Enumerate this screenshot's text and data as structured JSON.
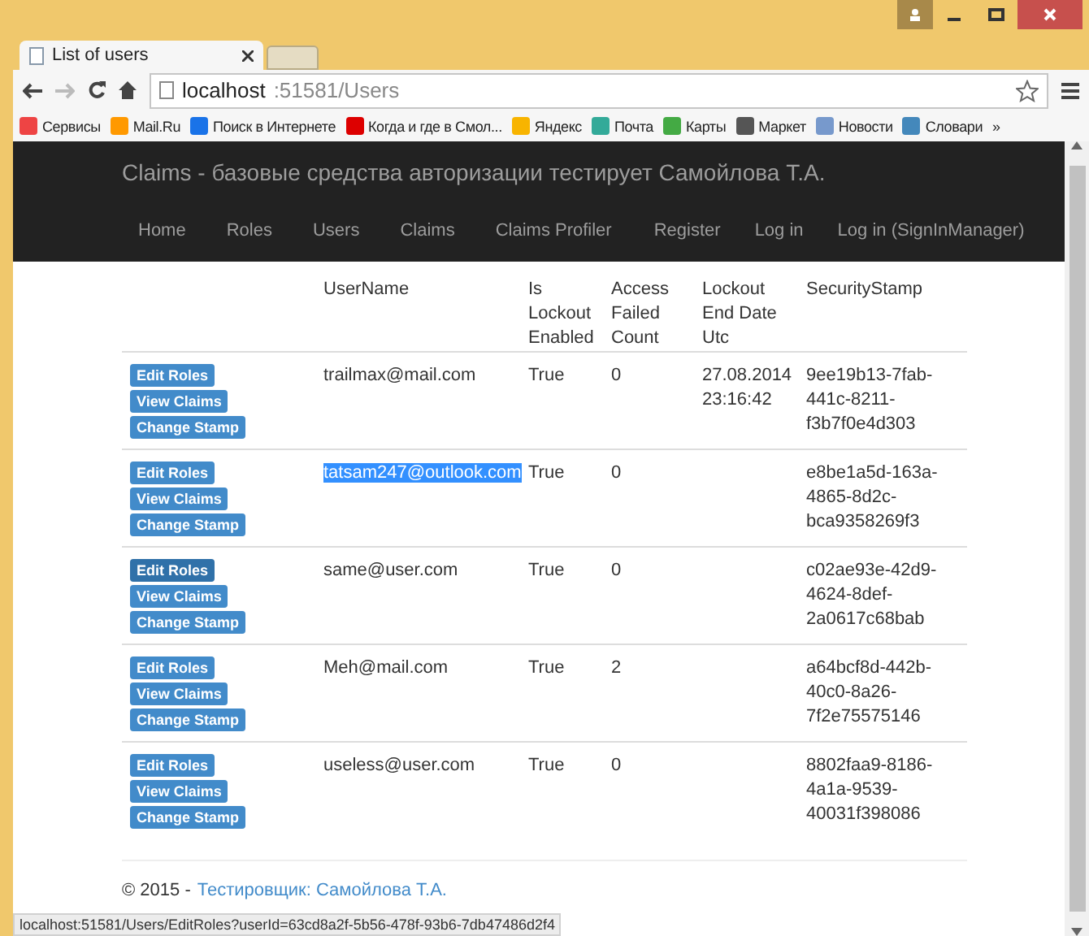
{
  "browser": {
    "tab": {
      "title": "List of users"
    },
    "address": {
      "host": "localhost",
      "path": ":51581/Users"
    },
    "bookmarks": [
      {
        "label": "Сервисы",
        "kind": "apps"
      },
      {
        "label": "Mail.Ru",
        "kind": "mail"
      },
      {
        "label": "Поиск в Интернете",
        "kind": "search"
      },
      {
        "label": "Когда и где в Смол...",
        "kind": "red"
      },
      {
        "label": "Яндекс",
        "kind": "bing"
      },
      {
        "label": "Почта",
        "kind": "windows"
      },
      {
        "label": "Карты",
        "kind": "maps"
      },
      {
        "label": "Маркет",
        "kind": "wiki"
      },
      {
        "label": "Новости",
        "kind": "page"
      },
      {
        "label": "Словари",
        "kind": "dict"
      }
    ],
    "more": "»",
    "status_url": "localhost:51581/Users/EditRoles?userId=63cd8a2f-5b56-478f-93b6-7db47486d2f4"
  },
  "navbar": {
    "brand": "Claims - базовые средства авторизации тестирует Самойлова Т.А.",
    "links": [
      "Home",
      "Roles",
      "Users",
      "Claims",
      "Claims Profiler"
    ],
    "right_links": [
      "Register",
      "Log in",
      "Log in (SignInManager)"
    ]
  },
  "table": {
    "columns": [
      "UserName",
      "Is Lockout Enabled",
      "Access Failed Count",
      "Lockout End Date Utc",
      "SecurityStamp"
    ],
    "rows": [
      {
        "buttons": [
          {
            "label": "Edit Roles",
            "hover": false
          },
          {
            "label": "View Claims",
            "hover": false
          },
          {
            "label": "Change Stamp",
            "hover": false
          }
        ],
        "username": "trailmax@mail.com",
        "text_selected": false,
        "lockout": "True",
        "failed": "0",
        "end_date": "27.08.2014 23:16:42",
        "stamp": "9ee19b13-7fab-441c-8211-f3b7f0e4d303"
      },
      {
        "buttons": [
          {
            "label": "Edit Roles",
            "hover": false
          },
          {
            "label": "View Claims",
            "hover": false
          },
          {
            "label": "Change Stamp",
            "hover": false
          }
        ],
        "username": "tatsam247@outlook.com",
        "text_selected": true,
        "lockout": "True",
        "failed": "0",
        "stamp": "e8be1a5d-163a-4865-8d2c-bca9358269f3"
      },
      {
        "buttons": [
          {
            "label": "Edit Roles",
            "hover": true
          },
          {
            "label": "View Claims",
            "hover": false
          },
          {
            "label": "Change Stamp",
            "hover": false
          }
        ],
        "username": "same@user.com",
        "text_selected": false,
        "lockout": "True",
        "failed": "0",
        "stamp": "c02ae93e-42d9-4624-8def-2a0617c68bab"
      },
      {
        "buttons": [
          {
            "label": "Edit Roles",
            "hover": false
          },
          {
            "label": "View Claims",
            "hover": false
          },
          {
            "label": "Change Stamp",
            "hover": false
          }
        ],
        "username": "Meh@mail.com",
        "text_selected": false,
        "lockout": "True",
        "failed": "2",
        "stamp": "a64bcf8d-442b-40c0-8a26-7f2e75575146"
      },
      {
        "buttons": [
          {
            "label": "Edit Roles",
            "hover": false
          },
          {
            "label": "View Claims",
            "hover": false
          },
          {
            "label": "Change Stamp",
            "hover": false
          }
        ],
        "username": "useless@user.com",
        "text_selected": false,
        "lockout": "True",
        "failed": "0",
        "stamp": "8802faa9-8186-4a1a-9539-40031f398086"
      }
    ]
  },
  "footer": {
    "copyright": "© 2015 -",
    "link": "Тестировщик: Самойлова Т.А."
  }
}
